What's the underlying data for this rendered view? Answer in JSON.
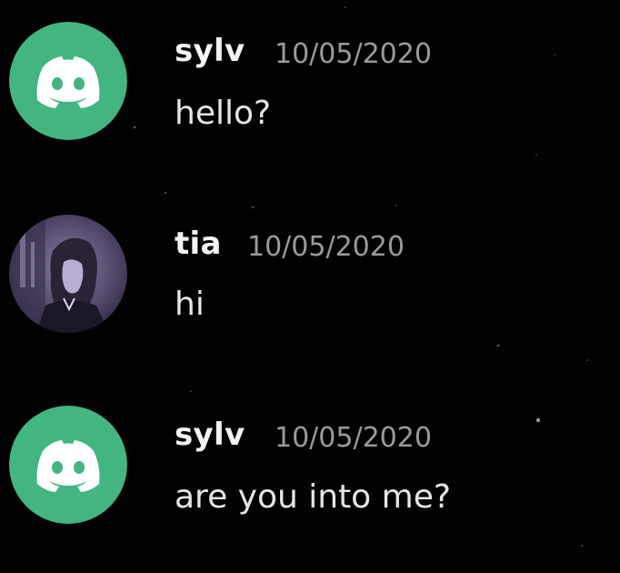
{
  "messages": [
    {
      "author": "sylv",
      "timestamp": "10/05/2020",
      "text": "hello?",
      "avatar": "discord-logo-avatar"
    },
    {
      "author": "tia",
      "timestamp": "10/05/2020",
      "text": "hi",
      "avatar": "user-photo-avatar"
    },
    {
      "author": "sylv",
      "timestamp": "10/05/2020",
      "text": "are you into me?",
      "avatar": "discord-logo-avatar"
    }
  ],
  "colors": {
    "background": "#020203",
    "discord_avatar": "#43b581",
    "username": "#f3f3f3",
    "timestamp": "#9a9a9a",
    "message_text": "#e6e6e6"
  }
}
